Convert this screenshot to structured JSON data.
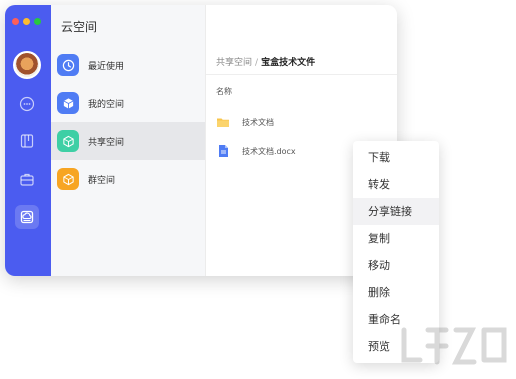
{
  "sidebar": {
    "nav_title": "云空间",
    "items": [
      {
        "label": "最近使用",
        "icon": "clock-icon",
        "color": "#4f7cf4"
      },
      {
        "label": "我的空间",
        "icon": "cube-icon",
        "color": "#4f7cf4"
      },
      {
        "label": "共享空间",
        "icon": "shared-cube-icon",
        "color": "#3ecfa5",
        "selected": true
      },
      {
        "label": "群空间",
        "icon": "group-cube-icon",
        "color": "#f7a523"
      }
    ]
  },
  "rail": {
    "icons": [
      "avatar",
      "chat-icon",
      "book-icon",
      "briefcase-icon",
      "cloud-drive-icon"
    ],
    "accent": "#4b5cf0"
  },
  "main": {
    "breadcrumb_parent": "共享空间",
    "breadcrumb_sep": "/",
    "breadcrumb_current": "宝盒技术文件",
    "column_name": "名称",
    "files": [
      {
        "name": "技术文档",
        "type": "folder-icon"
      },
      {
        "name": "技术文档.docx",
        "type": "docx-file-icon"
      }
    ]
  },
  "context_menu": {
    "items": [
      "下载",
      "转发",
      "分享链接",
      "复制",
      "移动",
      "删除",
      "重命名",
      "预览"
    ],
    "hovered": "分享链接"
  }
}
